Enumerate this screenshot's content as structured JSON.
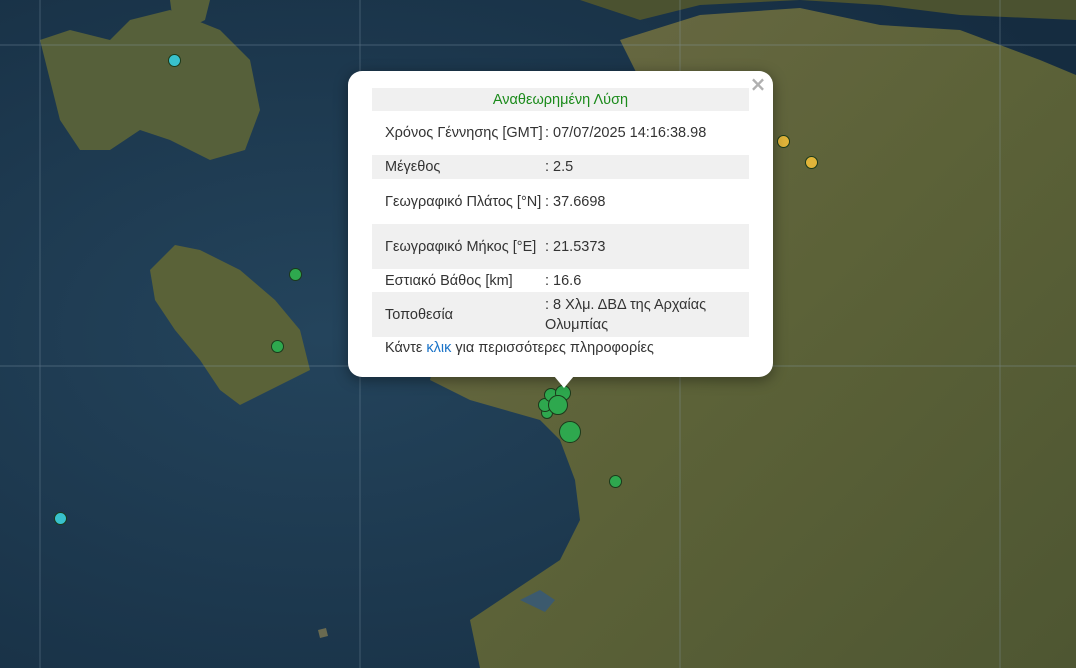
{
  "colors": {
    "sea": "#1c3a52",
    "land": "#5a5a3a",
    "marker_green": "#2ea84e",
    "marker_cyan": "#38c1cc",
    "marker_yellow": "#e0b43a",
    "popup_title": "#1a8a1a",
    "link": "#1a73c8"
  },
  "markers": [
    {
      "color": "cyan",
      "icon": "earthquake-marker"
    },
    {
      "color": "green",
      "icon": "earthquake-marker"
    },
    {
      "color": "green",
      "icon": "earthquake-marker"
    },
    {
      "color": "cyan",
      "icon": "earthquake-marker"
    },
    {
      "color": "yellow",
      "icon": "earthquake-marker"
    },
    {
      "color": "yellow",
      "icon": "earthquake-marker"
    },
    {
      "color": "green",
      "icon": "earthquake-marker"
    },
    {
      "color": "green",
      "icon": "earthquake-marker"
    }
  ],
  "popup": {
    "title": "Αναθεωρημένη Λύση",
    "close_symbol": "×",
    "rows": [
      {
        "label": "Χρόνος Γέννησης [GMT]",
        "value": ": 07/07/2025 14:16:38.98"
      },
      {
        "label": "Μέγεθος",
        "value": ": 2.5"
      },
      {
        "label": "Γεωγραφικό Πλάτος [°N]",
        "value": ": 37.6698"
      },
      {
        "label": "Γεωγραφικό Μήκος [°E]",
        "value": ": 21.5373"
      },
      {
        "label": "Εστιακό Βάθος [km]",
        "value": ": 16.6"
      },
      {
        "label": "Τοποθεσία",
        "value": ": 8 Χλμ. ΔΒΔ της Αρχαίας Ολυμπίας"
      }
    ],
    "more_prefix": "Κάντε",
    "more_link": "κλικ",
    "more_suffix": "για περισσότερες πληροφορίες"
  }
}
